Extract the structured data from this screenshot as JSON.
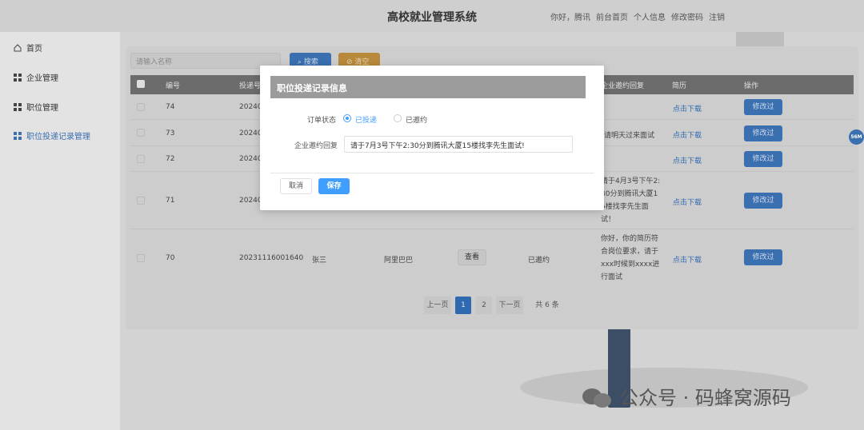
{
  "header": {
    "app_title": "高校就业管理系统",
    "greeting": "你好，",
    "username": "腾讯",
    "nav": [
      "前台首页",
      "个人信息",
      "修改密码",
      "注销"
    ]
  },
  "sidebar": {
    "items": [
      {
        "label": "首页",
        "icon": "home-icon"
      },
      {
        "label": "企业管理",
        "icon": "grid-icon"
      },
      {
        "label": "职位管理",
        "icon": "grid-icon"
      },
      {
        "label": "职位投递记录管理",
        "icon": "grid-icon",
        "active": true
      }
    ]
  },
  "toolbar": {
    "search_placeholder": "请输入名称",
    "search_label": "搜索",
    "reset_label": "清空"
  },
  "table": {
    "headers": [
      "编号",
      "投递号",
      "企业邀约回复",
      "简历",
      "操作"
    ],
    "rows": [
      {
        "id": "74",
        "code": "20240",
        "reply": "",
        "resume": "点击下载",
        "action": "修改过"
      },
      {
        "id": "73",
        "code": "20240",
        "reply": "请明天过来面试",
        "resume": "点击下载",
        "action": "修改过"
      },
      {
        "id": "72",
        "code": "20240",
        "reply": "",
        "resume": "点击下载",
        "action": "修改过"
      },
      {
        "id": "71",
        "code": "20240",
        "reply_lines": [
          "请于4月3号下午2:",
          "30分到腾讯大厦1",
          "5楼找李先生面",
          "试！"
        ],
        "resume": "点击下载",
        "action": "修改过"
      },
      {
        "id": "70",
        "code": "20231116001640",
        "name": "张三",
        "company": "阿里巴巴",
        "view": "查看",
        "status": "已邀约",
        "reply_lines": [
          "你好，你的简历符",
          "合岗位要求，请于",
          "xxx时候到xxxx进",
          "行面试"
        ],
        "resume": "点击下载",
        "action": "修改过"
      }
    ]
  },
  "pagination": {
    "prev": "上一页",
    "pages": [
      "1",
      "2"
    ],
    "next": "下一页",
    "total": "共 6 条"
  },
  "float_badge": "56M",
  "watermark": "公众号 · 码蜂窝源码",
  "modal": {
    "title": "职位投递记录信息",
    "status_label": "订单状态",
    "status_options": [
      "已投递",
      "已邀约"
    ],
    "reply_label": "企业邀约回复",
    "reply_value": "请于7月3号下午2:30分到腾讯大厦15楼找李先生面试!",
    "cancel_label": "取消",
    "save_label": "保存"
  }
}
